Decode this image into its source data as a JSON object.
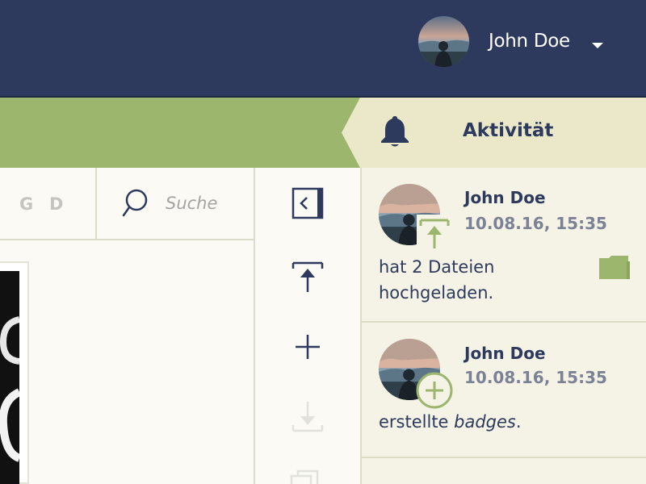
{
  "header": {
    "username": "John Doe",
    "menu_icon": "chevron-down-icon"
  },
  "activity": {
    "title": "Aktivität",
    "items": [
      {
        "name": "John Doe",
        "timestamp": "10.08.16, 15:35",
        "text": "hat 2 Dateien hochgeladen.",
        "badge_icon": "upload-icon",
        "attachment_icon": "folder-icon"
      },
      {
        "name": "John Doe",
        "timestamp": "10.08.16, 15:35",
        "text_prefix": "erstellte ",
        "text_emphasis": "badges",
        "text_suffix": ".",
        "badge_icon": "plus-circle-icon"
      }
    ]
  },
  "toolbar": {
    "letters": [
      "G",
      "D"
    ],
    "search_placeholder": "Suche"
  },
  "actions": [
    {
      "name": "collapse-panel-button",
      "icon": "chevron-left-icon"
    },
    {
      "name": "upload-button",
      "icon": "upload-icon"
    },
    {
      "name": "add-button",
      "icon": "plus-icon"
    },
    {
      "name": "download-button",
      "icon": "download-icon"
    },
    {
      "name": "copy-button",
      "icon": "copy-icon"
    }
  ],
  "colors": {
    "header": "#2d3a5d",
    "accent_green": "#9db66e",
    "activity_tab": "#ebe8c9",
    "panel": "#f5f3e6",
    "text_dark": "#2d3a5d",
    "text_muted": "#7b8296"
  }
}
